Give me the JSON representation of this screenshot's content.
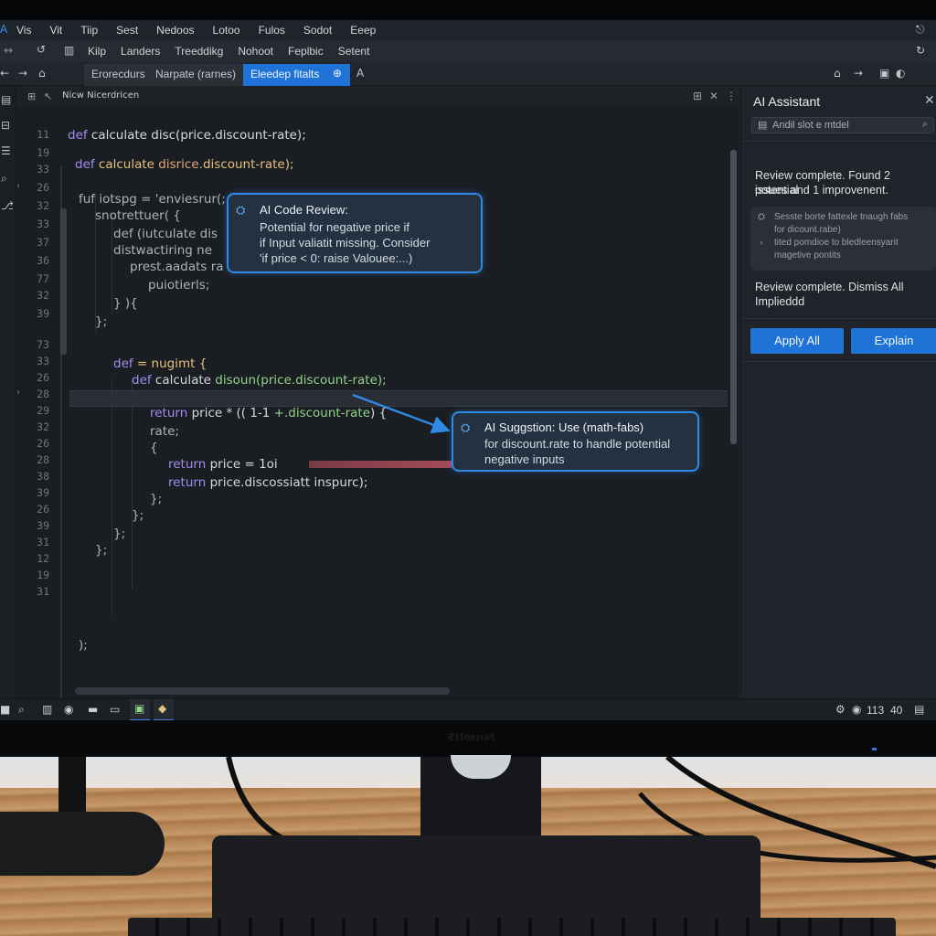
{
  "colors": {
    "accent": "#1f73d6",
    "popup_border": "#2f8ae6",
    "keyword": "#9f8ef0",
    "error_mark": "#a44a58"
  },
  "menubar": {
    "logo": "A",
    "items": [
      "Vis",
      "Vit",
      "Tiip",
      "Sest",
      "Nedoos",
      "Lotoo",
      "Fulos",
      "Sodot",
      "Eeep"
    ],
    "right_icon": "⎋"
  },
  "toolbar": {
    "nav": "↔",
    "refresh": "↺",
    "items": [
      "Kilp",
      "Landers",
      "Treeddikg",
      "Nohoot",
      "Feplbic",
      "Setent"
    ],
    "right_icon": "↻"
  },
  "tabs": {
    "back": "←",
    "forward": "→",
    "home": "⌂",
    "items": [
      {
        "label": "Erorecdurs"
      },
      {
        "label": "Narpate (rarnes)"
      },
      {
        "label": "Eleedep fitalts",
        "active": true
      }
    ],
    "add_icon": "⊕",
    "ai_icon": "A"
  },
  "editor": {
    "header_title": "Nicw Nicerdricen",
    "header_nav": "↖",
    "line_numbers": [
      "11",
      "19",
      "33",
      "26",
      "32",
      "33",
      "37",
      "36",
      "77",
      "32",
      "39",
      "73",
      "33",
      "26",
      "28",
      "29",
      "32",
      "26",
      "28",
      "38",
      "39",
      "26",
      "39",
      "31",
      "12",
      "19",
      "31"
    ],
    "code": {
      "l0_kw": "def",
      "l0_rest": " calculate disc(price.discount-rate);",
      "l1_kw": "def",
      "l1_fn": " calculate ",
      "l1_str": "disrice",
      "l1_rest": ".discount-rate);",
      "l2": "fuf iotspg = 'enviesrur(;",
      "l3": "snotrettuer( {",
      "l4": "def (iutculate dis",
      "l5": "distwactiring ne",
      "l6": "prest.aadats ra",
      "l7": "puiotierls;",
      "l8": "} ){",
      "l9": "};",
      "l10_kw": "def",
      "l10_rest": " = nugimt {",
      "l11_kw": "def",
      "l11_rest": " calculate ",
      "l11_grn": "disoun(price.discount-rate);",
      "l12_kw": "return",
      "l12_rest": " price * (( 1-1 ",
      "l12_grn": "+.discount-rate",
      "l12_end": ") {",
      "l13": "rate;",
      "l14": "{",
      "l15_kw": "return",
      "l15_rest": " price = 1oi",
      "l16_kw": "return",
      "l16_rest": " price.discossiatt inspurc);",
      "l17": "};",
      "l18": "};",
      "l19": "};",
      "l20": "};"
    }
  },
  "popup_review": {
    "title": "AI Code Review:",
    "lines": [
      "Potential for negative price if",
      "if Input valiatit missing. Consider",
      "'if price < 0: raise Valouee:...)"
    ],
    "icon": "bot-icon"
  },
  "popup_suggestion": {
    "title": "AI Suggstion: Use (math-fabs)",
    "lines": [
      "for discount.rate to handle potential",
      "negative inputs"
    ],
    "icon": "bot-icon"
  },
  "ai_panel": {
    "title": "AI Assistant",
    "close": "✕",
    "search_placeholder": "Andil slot e mtdel",
    "msg1": [
      "Review complete. Found 2 potential",
      "issues and 1 improvenent."
    ],
    "card": [
      "Sesste borte fattexle tnaugh fabs",
      "for dicount.rabe)",
      "tited pomdioe to bledleensyarit",
      "magetive pontits"
    ],
    "msg2": [
      "Review complete. Dismiss All",
      "Implieddd"
    ],
    "apply_all": "Apply All",
    "explain": "Explain"
  },
  "statusbar": {
    "right_text": "113",
    "right_text2": "40"
  },
  "monitor": {
    "brand": "Ƨtlosnat"
  }
}
